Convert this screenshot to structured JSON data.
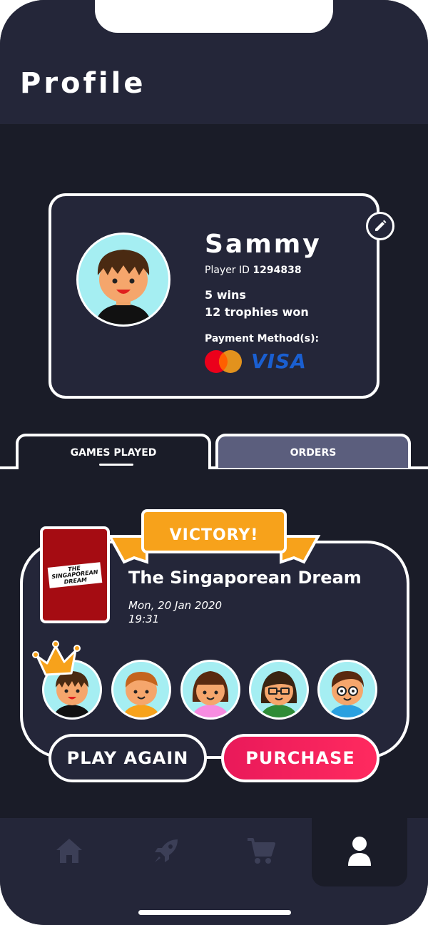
{
  "header": {
    "title": "Profile"
  },
  "profile": {
    "name": "Sammy",
    "player_id_label": "Player ID",
    "player_id": "1294838",
    "wins": "5 wins",
    "trophies": "12 trophies won",
    "payment_label": "Payment Method(s):",
    "payment_methods": [
      "mastercard",
      "visa"
    ],
    "visa_text": "VISA"
  },
  "tabs": [
    {
      "label": "GAMES PLAYED",
      "active": true
    },
    {
      "label": "ORDERS",
      "active": false
    }
  ],
  "game": {
    "badge": "VICTORY!",
    "title": "The Singaporean Dream",
    "date": "Mon, 20 Jan 2020",
    "time": "19:31",
    "cover_text": "THE SINGAPOREAN DREAM",
    "players": [
      "boy-black-shirt-winner",
      "boy-orange-shirt",
      "girl-pink-shirt",
      "girl-green-shirt-glasses",
      "boy-blue-shirt-glasses"
    ],
    "play_again_label": "PLAY AGAIN",
    "purchase_label": "PURCHASE"
  },
  "nav": {
    "items": [
      "home-icon",
      "rocket-icon",
      "cart-icon",
      "user-icon"
    ],
    "active": "user-icon"
  },
  "colors": {
    "background": "#1a1c28",
    "card": "#242639",
    "accent_orange": "#f7a21b",
    "accent_pink": "#f0205c",
    "tab_inactive": "#5b5e7d"
  }
}
